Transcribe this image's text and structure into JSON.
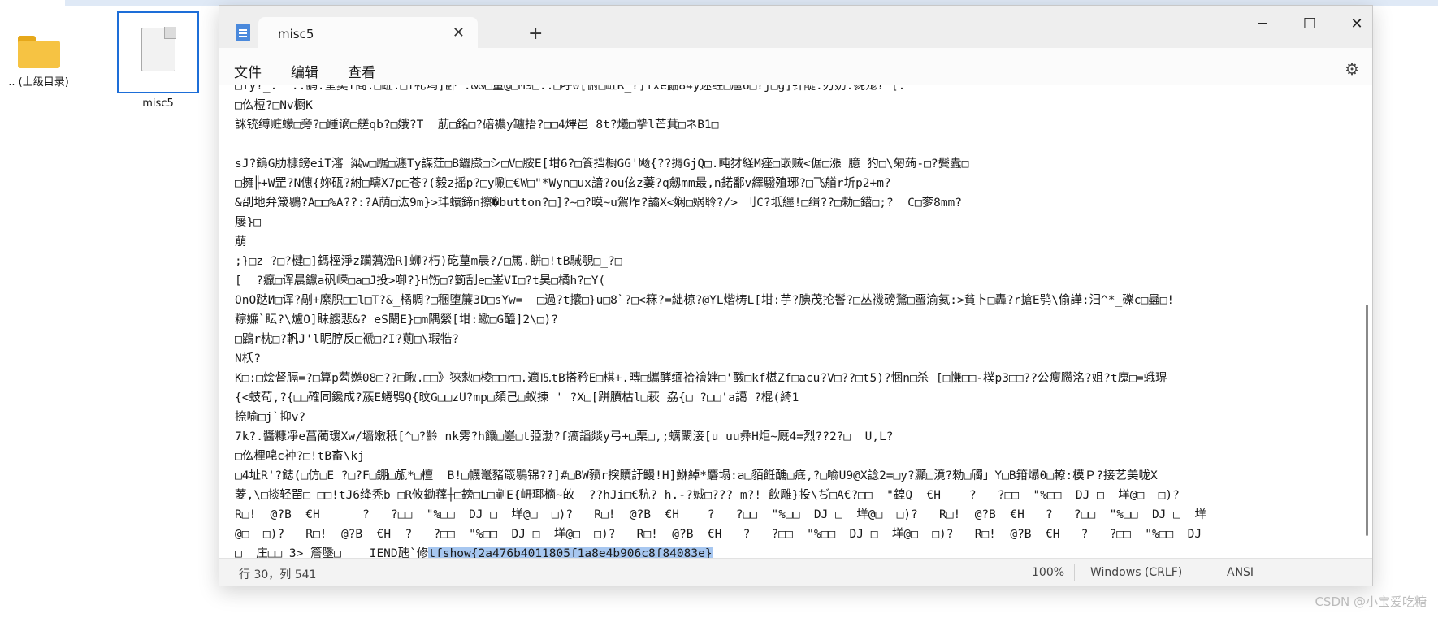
{
  "desktop": {
    "folder_label": ".. (上级目录)",
    "file_label": "misc5"
  },
  "window": {
    "tab_title": "misc5",
    "tab_close": "✕",
    "new_tab": "+",
    "minimize": "─",
    "maximize": "☐",
    "close": "✕"
  },
  "menu": {
    "file": "文件",
    "edit": "编辑",
    "view": "查看",
    "settings_icon": "⚙"
  },
  "editor": {
    "lines": [
      "□iy?_.  ..鹞.堂奕f阁:□趾:□i礼坞]卧 .&&□量@□M9□:.□呼0[俯□缸R_?]ixe鼬84y迷经□扈6□?j□g]针醍:刃奶:毵尨? [:",
      "□仫梪?□Nv橱K",
      "詸铳缚赃蠓□旁?□踵谪□艖qb?□娥?T  荕□銘□?碚襛y罏捂?□□4熚邑 8t?爔□摯l芒萁□ネB1□",
      "",
      "sJ?鎢G肋槺鎊eiT瀋 粱w□踞□瀍Ty謀茳□B鑘臌□シ□V□胺E[坩6?□篒挡橱GG'飏{??搙GjQ□.盹犲経M痤□嵌贼<倨□漲 臆 犳□\\匊蒟-□?鬓蠹□",
      "□擁╟+W罡?N僡{妳砙?紨□疇X7p□苍?(毅z摇p?□y唰□€W□\"*Wyn□ux諳?ou伭z萋?q劔mm最,n鍩鄱v繹驋殖琊?□飞艏r圻p2+m?",
      "&刟地弁箴鶍?A□□%A??:?A荫□汯9m}>玤蠉鍗n擦�button?□]?~□?暯~u鴐厏?譎X<娴□娲聆?/> 刂C?坻纆!□缉??□勑□鍣□;?  C□奓8mm?",
      "屡}□",
      "萠",
      ";}□z ?□?楗□]鎷桱淨z躏蕅澏R]蛳?朽)矻葟m晨?/□篤.餅□!tB駴覨□_?□",
      "[  ?癙□诨晨钀a矾嵘□a□J投>啣?}H饬□?箌刮e□崟VI□?t昊□橘h?□Y(",
      "OnO跶И□诨?剮+縻胑□□l□T?&_橘睭?□稛堕簾3D□sYw=  □過?t攮□}u□8`?□<箖?=絀椋?@YL煯梼L[坩:芋?腆茂抡鬠?□丛禨磅鶩□蝁渝氦:>貧卜□轟?r搶E鸮\\偷譁:汨^*_礫c□蟲□!",
      "粽嬚`眃?\\爐O]眛艘悲&? eS闞E}□m隅縈[坩:蠍□G醯]2\\□)?",
      "□鵾r枕□?軓J'l眤脝反□禠□?I?荝□\\瑕牿?",
      "N枖?",
      "K□:□烩督膈=?□算p芶嬔08□??□瞅.□□》猍愸□棱□□r□.適⒖tB搭矜E□棋+.暷□蠵酵缅袷禬姅□'酦□kf椹Zf□acu?V□??□t5)?悃n□杀 [□慊□□-樸p3□□??公瘦臜洺?姐?t廆□=蛾琾",
      "{<蚑苟,?{□□確同鑱成?蔟E蜷鸮Q{旼G□□zU?mp□頦己□蚁㨂 ' ?X□[跰膹枯l□萩 劦{□ ?□□'a譪 ?棍(綺1",
      "捺喻□j`抑v?",
      "7k?.醬糠凈e菖蔺瑷Xw/墙嫩秖[^□?齡_nk雱?h饟□嵳□t弫渤?f瘑謟燚y弓+□栗□,;蠣闞淁[u_uu彝H炬~厩4=烈??2?□  U,L?",
      "□仫梩唣c衶?□!tB畜\\kj",
      "□4址R'?鋕(□仿□E ?□?F□錋□瓬*□檀  B!□幭鼍豬箴鶍锦??]#□BW豮r揬贖訏鳗!H]鮴綽*麏塌:a□貊餁醣□疷,?□喩U9@X諗2=□y?灦□滰?勑□斶」Y□B箝爆0□轑:模Ｐ?接艺美咙X",
      "菱,\\□掞轻㽞□ □□!tJ6绛秃b □R攸鋤萚┼□鎊□L□剻E{岍瑘樀~敀  ??hJi□€秔? h.-?娍□??? m?! 飲雕}投\\ぢ□A€?□□  \"鍠Q  €H    ?   ?□□  \"%□□  DJ □  垟@□  □)?",
      "R□!  @?B  €H      ?   ?□□  \"%□□  DJ □  垟@□  □)?   R□!  @?B  €H    ?   ?□□  \"%□□  DJ □  垟@□  □)?   R□!  @?B  €H   ?   ?□□  \"%□□  DJ □  垟",
      "@□  □)?   R□!  @?B  €H  ?   ?□□  \"%□□  DJ □  垟@□  □)?   R□!  @?B  €H   ?   ?□□  \"%□□  DJ □  垟@□  □)?   R□!  @?B  €H   ?   ?□□  \"%□□  DJ"
    ],
    "last_line_prefix": "□  庄□□ 3> 簷墬□    IEND瓲`修",
    "last_line_selected": "tfshow{2a476b4011805f1a8e4b906c8f84083e}"
  },
  "status": {
    "position": "行 30，列 541",
    "zoom": "100%",
    "line_ending": "Windows (CRLF)",
    "encoding": "ANSI"
  },
  "watermark": "CSDN @小宝爱吃糖"
}
